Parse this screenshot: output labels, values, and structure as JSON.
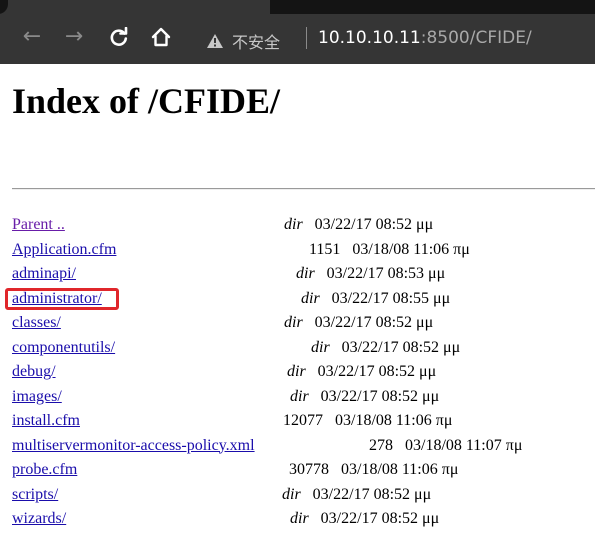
{
  "browser": {
    "security_text": "不安全",
    "url_host": "10.10.10.11",
    "url_rest": ":8500/CFIDE/",
    "back_icon": "arrow-left-icon",
    "forward_icon": "arrow-right-icon",
    "reload_icon": "reload-icon",
    "home_icon": "home-icon",
    "warning_icon": "warning-triangle-icon"
  },
  "page": {
    "title": "Index of /CFIDE/",
    "entries": [
      {
        "name": "Parent ..",
        "kind": "dir",
        "size": "",
        "datetime": "03/22/17 08:52 μμ"
      },
      {
        "name": "Application.cfm",
        "kind": "",
        "size": "1151",
        "datetime": "03/18/08 11:06 πμ"
      },
      {
        "name": "adminapi/",
        "kind": "dir",
        "size": "",
        "datetime": "03/22/17 08:53 μμ"
      },
      {
        "name": "administrator/",
        "kind": "dir",
        "size": "",
        "datetime": "03/22/17 08:55 μμ"
      },
      {
        "name": "classes/",
        "kind": "dir",
        "size": "",
        "datetime": "03/22/17 08:52 μμ"
      },
      {
        "name": "componentutils/",
        "kind": "dir",
        "size": "",
        "datetime": "03/22/17 08:52 μμ"
      },
      {
        "name": "debug/",
        "kind": "dir",
        "size": "",
        "datetime": "03/22/17 08:52 μμ"
      },
      {
        "name": "images/",
        "kind": "dir",
        "size": "",
        "datetime": "03/22/17 08:52 μμ"
      },
      {
        "name": "install.cfm",
        "kind": "",
        "size": "12077",
        "datetime": "03/18/08 11:06 πμ"
      },
      {
        "name": "multiservermonitor-access-policy.xml",
        "kind": "",
        "size": "278",
        "datetime": "03/18/08 11:07 πμ"
      },
      {
        "name": "probe.cfm",
        "kind": "",
        "size": "30778",
        "datetime": "03/18/08 11:06 πμ"
      },
      {
        "name": "scripts/",
        "kind": "dir",
        "size": "",
        "datetime": "03/22/17 08:52 μμ"
      },
      {
        "name": "wizards/",
        "kind": "dir",
        "size": "",
        "datetime": "03/22/17 08:52 μμ"
      }
    ]
  },
  "colors": {
    "link": "#1a0dab",
    "visited_link": "#681da8",
    "highlight_box": "#e0262b",
    "toolbar": "#353535"
  }
}
